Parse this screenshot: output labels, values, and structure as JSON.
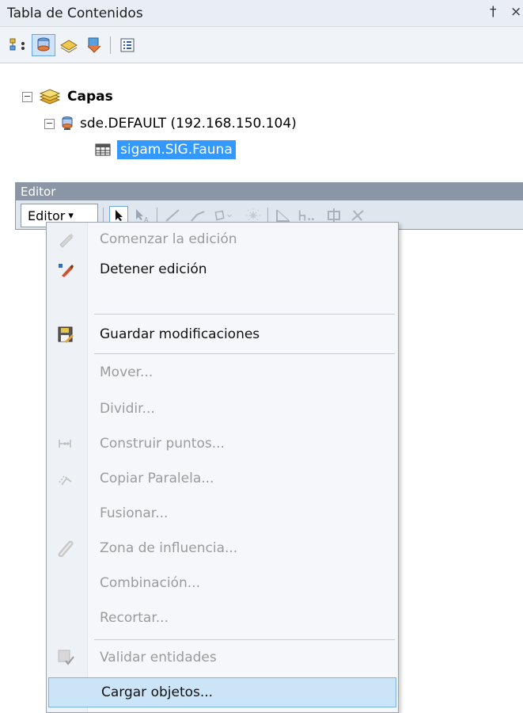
{
  "window": {
    "title": "Tabla de Contenidos",
    "pin_glyph": "Ԅ",
    "close_glyph": "×"
  },
  "toc_toolbar": {
    "buttons": [
      {
        "name": "list-by-drawing-order-icon"
      },
      {
        "name": "list-by-source-icon",
        "active": true
      },
      {
        "name": "list-by-visibility-icon"
      },
      {
        "name": "list-by-selection-icon"
      },
      {
        "name": "options-icon"
      }
    ]
  },
  "tree": {
    "root_label": "Capas",
    "connection_label": "sde.DEFAULT (192.168.150.104)",
    "layer_label": "sigam.SIG.Fauna",
    "expander_glyph": "−"
  },
  "editor_toolbar": {
    "title": "Editor",
    "dropdown_label": "Editor",
    "dropdown_arrow": "▾"
  },
  "menu": {
    "items": [
      {
        "label": "Comenzar la edición",
        "icon": "start-editing-icon",
        "enabled": false
      },
      {
        "label": "Detener edición",
        "icon": "stop-editing-icon",
        "enabled": true
      },
      {
        "label": "Guardar modificaciones",
        "icon": "save-edits-icon",
        "enabled": true
      },
      {
        "label": "Mover...",
        "icon": "",
        "enabled": false
      },
      {
        "label": "Dividir...",
        "icon": "",
        "enabled": false
      },
      {
        "label": "Construir puntos...",
        "icon": "construct-points-icon",
        "enabled": false
      },
      {
        "label": "Copiar Paralela...",
        "icon": "copy-parallel-icon",
        "enabled": false
      },
      {
        "label": "Fusionar...",
        "icon": "",
        "enabled": false
      },
      {
        "label": "Zona de influencia...",
        "icon": "buffer-icon",
        "enabled": false
      },
      {
        "label": "Combinación...",
        "icon": "",
        "enabled": false
      },
      {
        "label": "Recortar...",
        "icon": "",
        "enabled": false
      },
      {
        "label": "Validar entidades",
        "icon": "validate-features-icon",
        "enabled": false
      },
      {
        "label": "Cargar objetos...",
        "icon": "",
        "enabled": true,
        "highlighted": true
      }
    ]
  }
}
